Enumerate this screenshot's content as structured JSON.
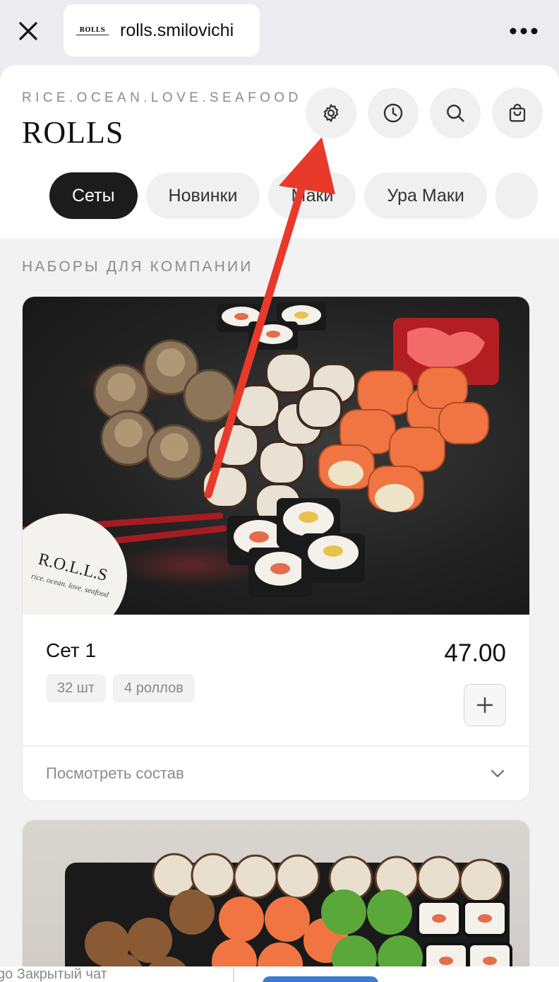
{
  "browser": {
    "url": "rolls.smilovichi",
    "logo_text": "ROLLS"
  },
  "header": {
    "tagline": "RICE.OCEAN.LOVE.SEAFOOD",
    "brand": "ROLLS",
    "icons": [
      "gear-icon",
      "clock-icon",
      "search-icon",
      "bag-icon"
    ]
  },
  "tabs": [
    {
      "label": "Сеты",
      "active": true
    },
    {
      "label": "Новинки",
      "active": false
    },
    {
      "label": "Маки",
      "active": false
    },
    {
      "label": "Ура Маки",
      "active": false
    }
  ],
  "section": {
    "title": "НАБОРЫ ДЛЯ КОМПАНИИ"
  },
  "products": [
    {
      "title": "Сет 1",
      "price": "47.00",
      "tags": [
        "32 шт",
        "4 роллов"
      ],
      "composition_label": "Посмотреть состав",
      "photo_badge": {
        "logo": "R.O.L.L.S",
        "sub": "rice. ocean. love. seafood"
      }
    }
  ],
  "bottom_bar": {
    "left_text": "go Закрытый чат"
  },
  "colors": {
    "accent_arrow": "#e8392b",
    "active_tab_bg": "#1c1c1c",
    "pill_bg": "#f0f0f0"
  }
}
